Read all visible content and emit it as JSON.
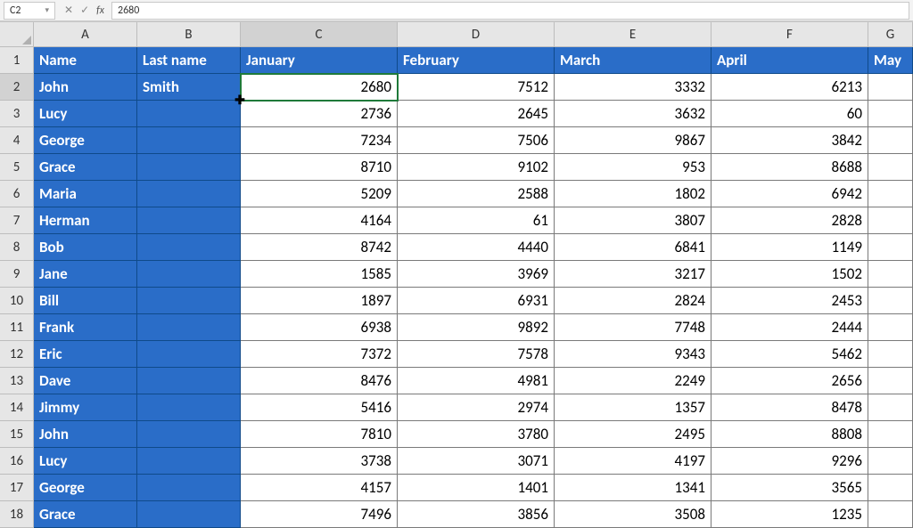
{
  "formula_bar": {
    "cell_ref": "C2",
    "value": "2680"
  },
  "columns": [
    "A",
    "B",
    "C",
    "D",
    "E",
    "F",
    "G"
  ],
  "headers": {
    "A": "Name",
    "B": "Last name",
    "C": "January",
    "D": "February",
    "E": "March",
    "F": "April",
    "G": "May"
  },
  "rows": [
    {
      "n": 1
    },
    {
      "n": 2,
      "name": "John",
      "last": "Smith",
      "jan": "2680",
      "feb": "7512",
      "mar": "3332",
      "apr": "6213"
    },
    {
      "n": 3,
      "name": "Lucy",
      "last": "",
      "jan": "2736",
      "feb": "2645",
      "mar": "3632",
      "apr": "60"
    },
    {
      "n": 4,
      "name": "George",
      "last": "",
      "jan": "7234",
      "feb": "7506",
      "mar": "9867",
      "apr": "3842"
    },
    {
      "n": 5,
      "name": "Grace",
      "last": "",
      "jan": "8710",
      "feb": "9102",
      "mar": "953",
      "apr": "8688"
    },
    {
      "n": 6,
      "name": "Maria",
      "last": "",
      "jan": "5209",
      "feb": "2588",
      "mar": "1802",
      "apr": "6942"
    },
    {
      "n": 7,
      "name": "Herman",
      "last": "",
      "jan": "4164",
      "feb": "61",
      "mar": "3807",
      "apr": "2828"
    },
    {
      "n": 8,
      "name": "Bob",
      "last": "",
      "jan": "8742",
      "feb": "4440",
      "mar": "6841",
      "apr": "1149"
    },
    {
      "n": 9,
      "name": "Jane",
      "last": "",
      "jan": "1585",
      "feb": "3969",
      "mar": "3217",
      "apr": "1502"
    },
    {
      "n": 10,
      "name": "Bill",
      "last": "",
      "jan": "1897",
      "feb": "6931",
      "mar": "2824",
      "apr": "2453"
    },
    {
      "n": 11,
      "name": "Frank",
      "last": "",
      "jan": "6938",
      "feb": "9892",
      "mar": "7748",
      "apr": "2444"
    },
    {
      "n": 12,
      "name": "Eric",
      "last": "",
      "jan": "7372",
      "feb": "7578",
      "mar": "9343",
      "apr": "5462"
    },
    {
      "n": 13,
      "name": "Dave",
      "last": "",
      "jan": "8476",
      "feb": "4981",
      "mar": "2249",
      "apr": "2656"
    },
    {
      "n": 14,
      "name": "Jimmy",
      "last": "",
      "jan": "5416",
      "feb": "2974",
      "mar": "1357",
      "apr": "8478"
    },
    {
      "n": 15,
      "name": "John",
      "last": "",
      "jan": "7810",
      "feb": "3780",
      "mar": "2495",
      "apr": "8808"
    },
    {
      "n": 16,
      "name": "Lucy",
      "last": "",
      "jan": "3738",
      "feb": "3071",
      "mar": "4197",
      "apr": "9296"
    },
    {
      "n": 17,
      "name": "George",
      "last": "",
      "jan": "4157",
      "feb": "1401",
      "mar": "1341",
      "apr": "3565"
    },
    {
      "n": 18,
      "name": "Grace",
      "last": "",
      "jan": "7496",
      "feb": "3856",
      "mar": "3508",
      "apr": "1235"
    }
  ],
  "active_cell": "C2",
  "colors": {
    "frozen_bg": "#2a6dc8",
    "active_outline": "#1f7a3a"
  },
  "chart_data": {
    "type": "table",
    "title": "",
    "columns": [
      "Name",
      "Last name",
      "January",
      "February",
      "March",
      "April",
      "May"
    ],
    "rows": [
      [
        "John",
        "Smith",
        2680,
        7512,
        3332,
        6213,
        null
      ],
      [
        "Lucy",
        "",
        2736,
        2645,
        3632,
        60,
        null
      ],
      [
        "George",
        "",
        7234,
        7506,
        9867,
        3842,
        null
      ],
      [
        "Grace",
        "",
        8710,
        9102,
        953,
        8688,
        null
      ],
      [
        "Maria",
        "",
        5209,
        2588,
        1802,
        6942,
        null
      ],
      [
        "Herman",
        "",
        4164,
        61,
        3807,
        2828,
        null
      ],
      [
        "Bob",
        "",
        8742,
        4440,
        6841,
        1149,
        null
      ],
      [
        "Jane",
        "",
        1585,
        3969,
        3217,
        1502,
        null
      ],
      [
        "Bill",
        "",
        1897,
        6931,
        2824,
        2453,
        null
      ],
      [
        "Frank",
        "",
        6938,
        9892,
        7748,
        2444,
        null
      ],
      [
        "Eric",
        "",
        7372,
        7578,
        9343,
        5462,
        null
      ],
      [
        "Dave",
        "",
        8476,
        4981,
        2249,
        2656,
        null
      ],
      [
        "Jimmy",
        "",
        5416,
        2974,
        1357,
        8478,
        null
      ],
      [
        "John",
        "",
        7810,
        3780,
        2495,
        8808,
        null
      ],
      [
        "Lucy",
        "",
        3738,
        3071,
        4197,
        9296,
        null
      ],
      [
        "George",
        "",
        4157,
        1401,
        1341,
        3565,
        null
      ],
      [
        "Grace",
        "",
        7496,
        3856,
        3508,
        1235,
        null
      ]
    ]
  }
}
